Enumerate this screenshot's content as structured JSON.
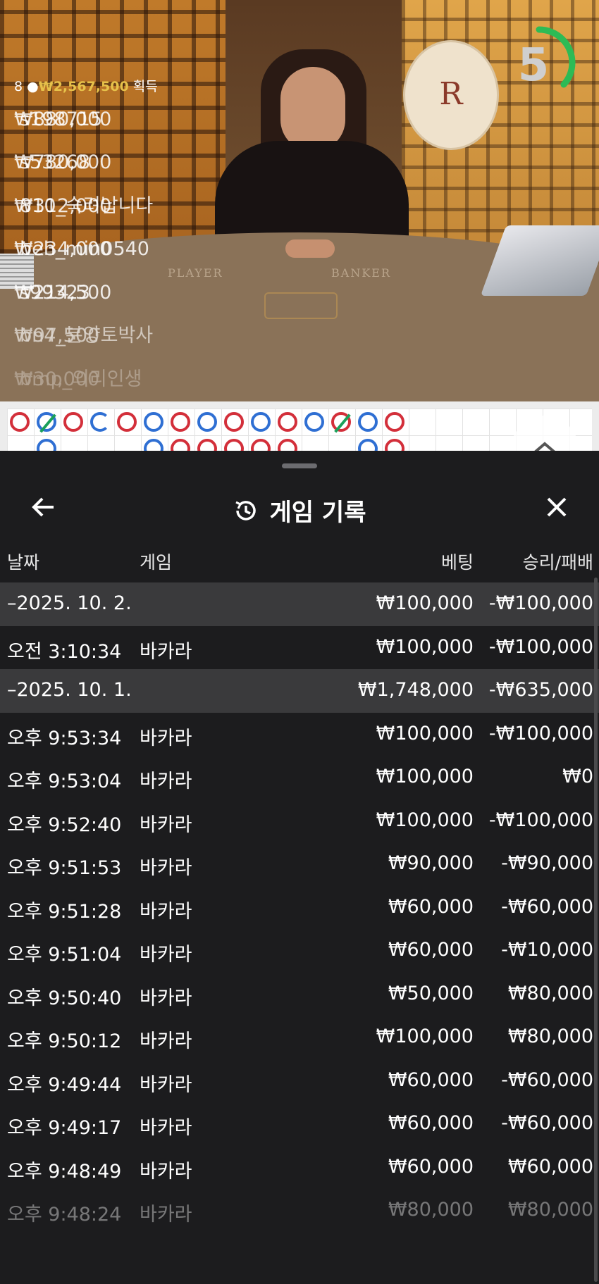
{
  "video": {
    "timer": "5",
    "felt_player": "PLAYER",
    "felt_banker": "BANKER",
    "logo_letter": "R",
    "winners": {
      "count": "8",
      "total": "₩2,567,500",
      "suffix": "획득",
      "list": [
        {
          "amount": "₩880,000",
          "name": "s198715"
        },
        {
          "amount": "₩780,000",
          "name": "s53268"
        },
        {
          "amount": "₩312,000",
          "name": "810_숙려납니다"
        },
        {
          "amount": "₩234,000",
          "name": "beh_min0540"
        },
        {
          "amount": "₩214,500",
          "name": "s99323"
        },
        {
          "amount": "₩97,500",
          "name": "bn4_분양토박사"
        },
        {
          "amount": "₩30,000",
          "name": "bmp_의리인생"
        }
      ]
    }
  },
  "roadmap": {
    "top_row": [
      "r",
      "b-slash",
      "r",
      "b-open",
      "r",
      "b",
      "r",
      "b",
      "r",
      "b",
      "r",
      "b",
      "r-slash",
      "b",
      "r"
    ],
    "second_row": [
      "",
      "b",
      "",
      "",
      "",
      "b",
      "r",
      "r",
      "r",
      "r",
      "r",
      "",
      "",
      "b",
      "r"
    ]
  },
  "sheet": {
    "title": "게임 기록",
    "columns": {
      "date": "날짜",
      "game": "게임",
      "bet": "베팅",
      "winloss": "승리/패배"
    },
    "rows": [
      {
        "type": "date",
        "date": "–2025. 10. 2.",
        "game": "",
        "bet": "₩100,000",
        "winloss": "-₩100,000"
      },
      {
        "type": "game",
        "date": "오전 3:10:34",
        "game": "바카라",
        "bet": "₩100,000",
        "winloss": "-₩100,000"
      },
      {
        "type": "date",
        "date": "–2025. 10. 1.",
        "game": "",
        "bet": "₩1,748,000",
        "winloss": "-₩635,000"
      },
      {
        "type": "game",
        "date": "오후 9:53:34",
        "game": "바카라",
        "bet": "₩100,000",
        "winloss": "-₩100,000"
      },
      {
        "type": "game",
        "date": "오후 9:53:04",
        "game": "바카라",
        "bet": "₩100,000",
        "winloss": "₩0"
      },
      {
        "type": "game",
        "date": "오후 9:52:40",
        "game": "바카라",
        "bet": "₩100,000",
        "winloss": "-₩100,000"
      },
      {
        "type": "game",
        "date": "오후 9:51:53",
        "game": "바카라",
        "bet": "₩90,000",
        "winloss": "-₩90,000"
      },
      {
        "type": "game",
        "date": "오후 9:51:28",
        "game": "바카라",
        "bet": "₩60,000",
        "winloss": "-₩60,000"
      },
      {
        "type": "game",
        "date": "오후 9:51:04",
        "game": "바카라",
        "bet": "₩60,000",
        "winloss": "-₩10,000"
      },
      {
        "type": "game",
        "date": "오후 9:50:40",
        "game": "바카라",
        "bet": "₩50,000",
        "winloss": "₩80,000"
      },
      {
        "type": "game",
        "date": "오후 9:50:12",
        "game": "바카라",
        "bet": "₩100,000",
        "winloss": "₩80,000"
      },
      {
        "type": "game",
        "date": "오후 9:49:44",
        "game": "바카라",
        "bet": "₩60,000",
        "winloss": "-₩60,000"
      },
      {
        "type": "game",
        "date": "오후 9:49:17",
        "game": "바카라",
        "bet": "₩60,000",
        "winloss": "-₩60,000"
      },
      {
        "type": "game",
        "date": "오후 9:48:49",
        "game": "바카라",
        "bet": "₩60,000",
        "winloss": "₩60,000"
      },
      {
        "type": "game",
        "date": "오후 9:48:24",
        "game": "바카라",
        "bet": "₩80,000",
        "winloss": "₩80,000"
      }
    ]
  },
  "colors": {
    "sheet_bg": "#1c1c1e",
    "date_row_bg": "#3a3a3c",
    "timer_green": "#2dbb55",
    "bead_red": "#d32f3a",
    "bead_blue": "#2f6fd3",
    "gold": "#e6c14a"
  },
  "icons": {
    "back": "arrow-left-icon",
    "history": "history-icon",
    "close": "close-icon",
    "expand": "chevron-up-icon"
  }
}
